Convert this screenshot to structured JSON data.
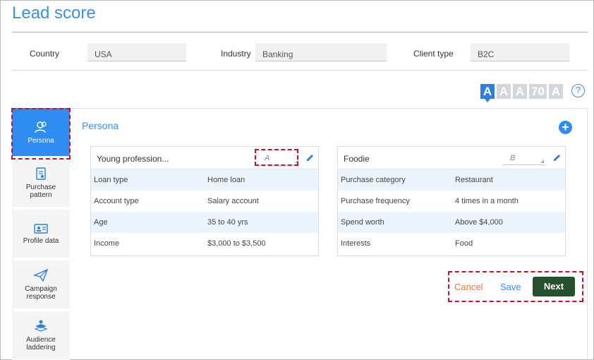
{
  "page": {
    "title": "Lead score"
  },
  "filters": [
    {
      "label": "Country",
      "value": "USA"
    },
    {
      "label": "Industry",
      "value": "Banking"
    },
    {
      "label": "Client type",
      "value": "B2C"
    }
  ],
  "score_badges": [
    "A",
    "A",
    "A",
    "70",
    "A"
  ],
  "help_label": "?",
  "sidebar": {
    "items": [
      {
        "label": "Persona",
        "icon": "persona-icon"
      },
      {
        "label": "Purchase pattern",
        "icon": "purchase-pattern-icon"
      },
      {
        "label": "Profile data",
        "icon": "profile-card-icon"
      },
      {
        "label": "Campaign response",
        "icon": "paper-plane-icon"
      },
      {
        "label": "Audience laddering",
        "icon": "stack-icon"
      }
    ]
  },
  "section": {
    "title": "Persona",
    "add_label": "+"
  },
  "personas": [
    {
      "name": "Young profession...",
      "grade": "A",
      "rows": [
        {
          "key": "Loan type",
          "value": "Home loan"
        },
        {
          "key": "Account type",
          "value": "Salary account"
        },
        {
          "key": "Age",
          "value": "35 to 40 yrs"
        },
        {
          "key": "Income",
          "value": "$3,000 to $3,500"
        }
      ]
    },
    {
      "name": "Foodie",
      "grade": "B",
      "rows": [
        {
          "key": "Purchase category",
          "value": "Restaurant"
        },
        {
          "key": "Purchase frequency",
          "value": "4 times in a month"
        },
        {
          "key": "Spend worth",
          "value": "Above $4,000"
        },
        {
          "key": "Interests",
          "value": "Food"
        }
      ]
    }
  ],
  "actions": {
    "cancel": "Cancel",
    "save": "Save",
    "next": "Next"
  },
  "colors": {
    "accent": "#2f8cf0",
    "next_button": "#26512f",
    "cancel_text": "#e8774a",
    "highlight": "#c8102e"
  }
}
